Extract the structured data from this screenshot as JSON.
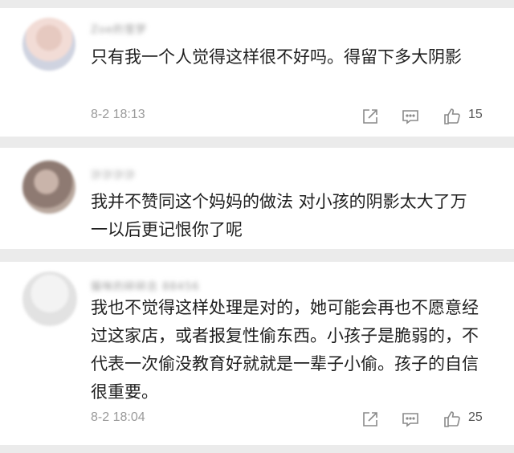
{
  "comments": [
    {
      "username": "Zoe的雪梦",
      "text": "只有我一个人觉得这样很不好吗。得留下多大阴影",
      "time": "8-2 18:13",
      "likes": "15"
    },
    {
      "username": "沙沙沙沙",
      "text": "我并不赞同这个妈妈的做法 对小孩的阴影太大了万一以后更记恨你了呢"
    },
    {
      "username": "猫咪的碎碎念 88456",
      "text": "我也不觉得这样处理是对的，她可能会再也不愿意经过这家店，或者报复性偷东西。小孩子是脆弱的，不代表一次偷没教育好就就是一辈子小偷。孩子的自信很重要。",
      "time": "8-2 18:04",
      "likes": "25"
    }
  ],
  "icons": {
    "share": "share-icon",
    "comment": "comment-icon",
    "like": "thumbs-up-icon"
  },
  "colors": {
    "background": "#ebebeb",
    "card": "#ffffff",
    "meta": "#9a9a9a",
    "text": "#1f1f1f"
  }
}
